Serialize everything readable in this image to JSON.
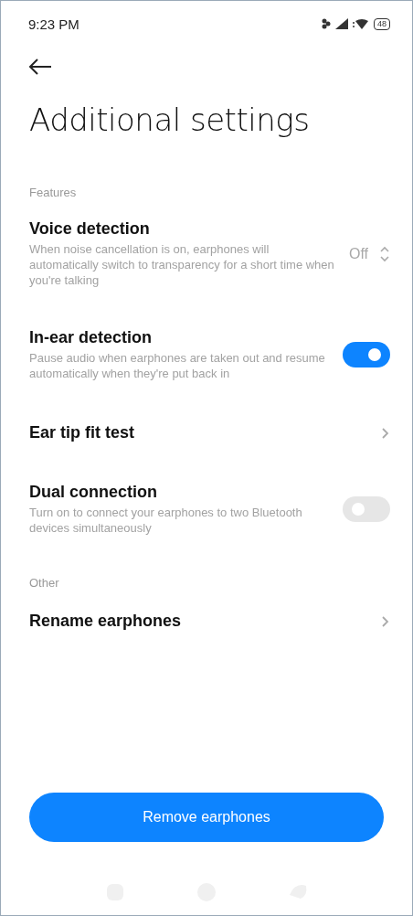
{
  "status_bar": {
    "time": "9:23 PM",
    "battery": "48"
  },
  "title": "Additional settings",
  "sections": [
    {
      "header": "Features",
      "items": [
        {
          "kind": "select",
          "title": "Voice detection",
          "description": "When noise cancellation is on, earphones will automatically switch to transparency for a short time when you're talking",
          "value": "Off"
        },
        {
          "kind": "toggle",
          "title": "In-ear detection",
          "description": "Pause audio when earphones are taken out and resume automatically when they're put back in",
          "on": true
        },
        {
          "kind": "link",
          "title": "Ear tip fit test"
        },
        {
          "kind": "toggle",
          "title": "Dual connection",
          "description": "Turn on to connect your earphones to two Bluetooth devices simultaneously",
          "on": false
        }
      ]
    },
    {
      "header": "Other",
      "items": [
        {
          "kind": "link",
          "title": "Rename earphones"
        }
      ]
    }
  ],
  "button": "Remove earphones"
}
